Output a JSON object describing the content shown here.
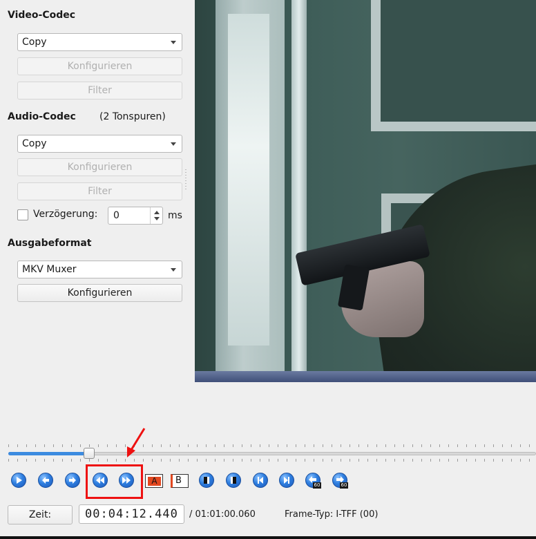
{
  "video_codec": {
    "title": "Video-Codec",
    "selected": "Copy",
    "configure_label": "Konfigurieren",
    "filter_label": "Filter"
  },
  "audio_codec": {
    "title": "Audio-Codec",
    "tracks_note": "(2 Tonspuren)",
    "selected": "Copy",
    "configure_label": "Konfigurieren",
    "filter_label": "Filter",
    "delay_label": "Verzögerung:",
    "delay_value": "0",
    "delay_unit": "ms"
  },
  "output_format": {
    "title": "Ausgabeformat",
    "selected": "MKV Muxer",
    "configure_label": "Konfigurieren"
  },
  "playback": {
    "position_fraction": 0.153,
    "time_button_label": "Zeit:",
    "current_time": "00:04:12.440",
    "total_time": "/ 01:01:00.060",
    "frame_type": "Frame-Typ:  I-TFF (00)"
  },
  "toolbar": {
    "icons": [
      "play-icon",
      "previous-frame-icon",
      "next-frame-icon",
      "previous-keyframe-icon",
      "next-keyframe-icon",
      "set-marker-a-icon",
      "set-marker-b-icon",
      "previous-black-frame-icon",
      "next-black-frame-icon",
      "go-to-start-icon",
      "go-to-end-icon",
      "back-60s-icon",
      "forward-60s-icon"
    ],
    "marker_a_label": "A",
    "marker_b_label": "B",
    "badge_60": "60"
  },
  "colors": {
    "accent": "#3c8be0",
    "annotation": "#ee1111",
    "marker": "#e2471f"
  }
}
